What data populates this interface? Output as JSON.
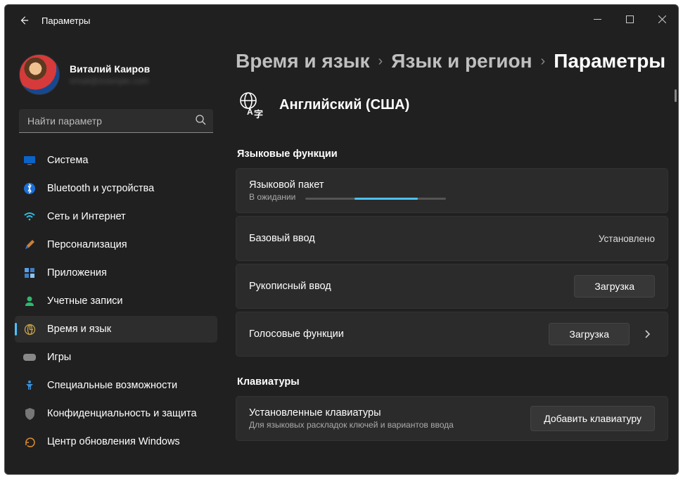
{
  "window": {
    "title": "Параметры"
  },
  "user": {
    "name": "Виталий Каиров",
    "email": "email@example.com"
  },
  "search": {
    "placeholder": "Найти параметр"
  },
  "sidebar": {
    "items": [
      {
        "label": "Система"
      },
      {
        "label": "Bluetooth и устройства"
      },
      {
        "label": "Сеть и Интернет"
      },
      {
        "label": "Персонализация"
      },
      {
        "label": "Приложения"
      },
      {
        "label": "Учетные записи"
      },
      {
        "label": "Время и язык"
      },
      {
        "label": "Игры"
      },
      {
        "label": "Специальные возможности"
      },
      {
        "label": "Конфиденциальность и защита"
      },
      {
        "label": "Центр обновления Windows"
      }
    ]
  },
  "breadcrumb": {
    "a": "Время и язык",
    "b": "Язык и регион",
    "c": "Параметры"
  },
  "language": {
    "name": "Английский (США)"
  },
  "sections": {
    "features": "Языковые функции",
    "keyboards": "Клавиатуры"
  },
  "features": {
    "langpack": {
      "title": "Языковой пакет",
      "status": "В ожидании"
    },
    "basic": {
      "title": "Базовый ввод",
      "status": "Установлено"
    },
    "hand": {
      "title": "Рукописный ввод",
      "button": "Загрузка"
    },
    "voice": {
      "title": "Голосовые функции",
      "button": "Загрузка"
    }
  },
  "keyboards": {
    "installed": {
      "title": "Установленные клавиатуры",
      "sub": "Для языковых раскладок ключей и вариантов ввода"
    },
    "add_button": "Добавить клавиатуру"
  }
}
